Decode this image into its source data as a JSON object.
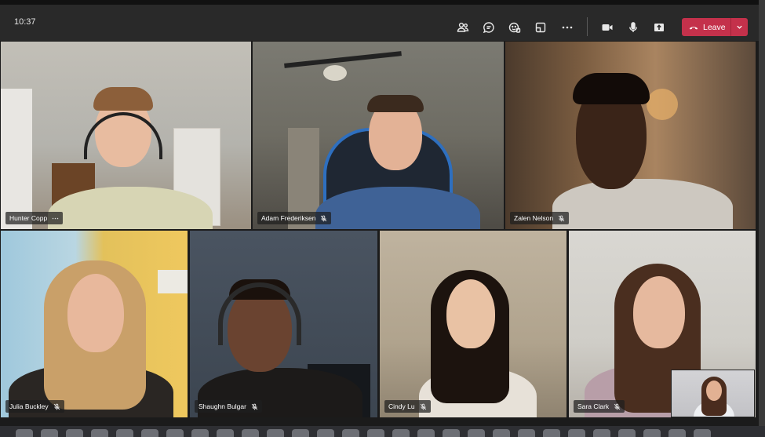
{
  "window": {
    "time": "10:37"
  },
  "toolbar": {
    "buttons": [
      {
        "name": "participants-button",
        "icon": "participants-icon"
      },
      {
        "name": "chat-button",
        "icon": "chat-icon"
      },
      {
        "name": "reactions-button",
        "icon": "reactions-icon"
      },
      {
        "name": "rooms-button",
        "icon": "rooms-icon"
      },
      {
        "name": "more-actions-button",
        "icon": "more-icon"
      },
      {
        "name": "camera-button",
        "icon": "camera-icon"
      },
      {
        "name": "mic-button",
        "icon": "mic-icon"
      },
      {
        "name": "share-button",
        "icon": "share-icon"
      }
    ],
    "leave_label": "Leave",
    "leave_color": "#c4314b"
  },
  "participants": [
    {
      "name": "Hunter Copp",
      "status": "more-icon"
    },
    {
      "name": "Adam Frederiksen",
      "status": "muted-mic-icon"
    },
    {
      "name": "Zalen Nelson",
      "status": "muted-mic-icon"
    },
    {
      "name": "Julia Buckley",
      "status": "muted-mic-icon"
    },
    {
      "name": "Shaughn Bulgar",
      "status": "muted-mic-icon"
    },
    {
      "name": "Cindy Lu",
      "status": "muted-mic-icon"
    },
    {
      "name": "Sara Clark",
      "status": "muted-mic-icon"
    }
  ]
}
